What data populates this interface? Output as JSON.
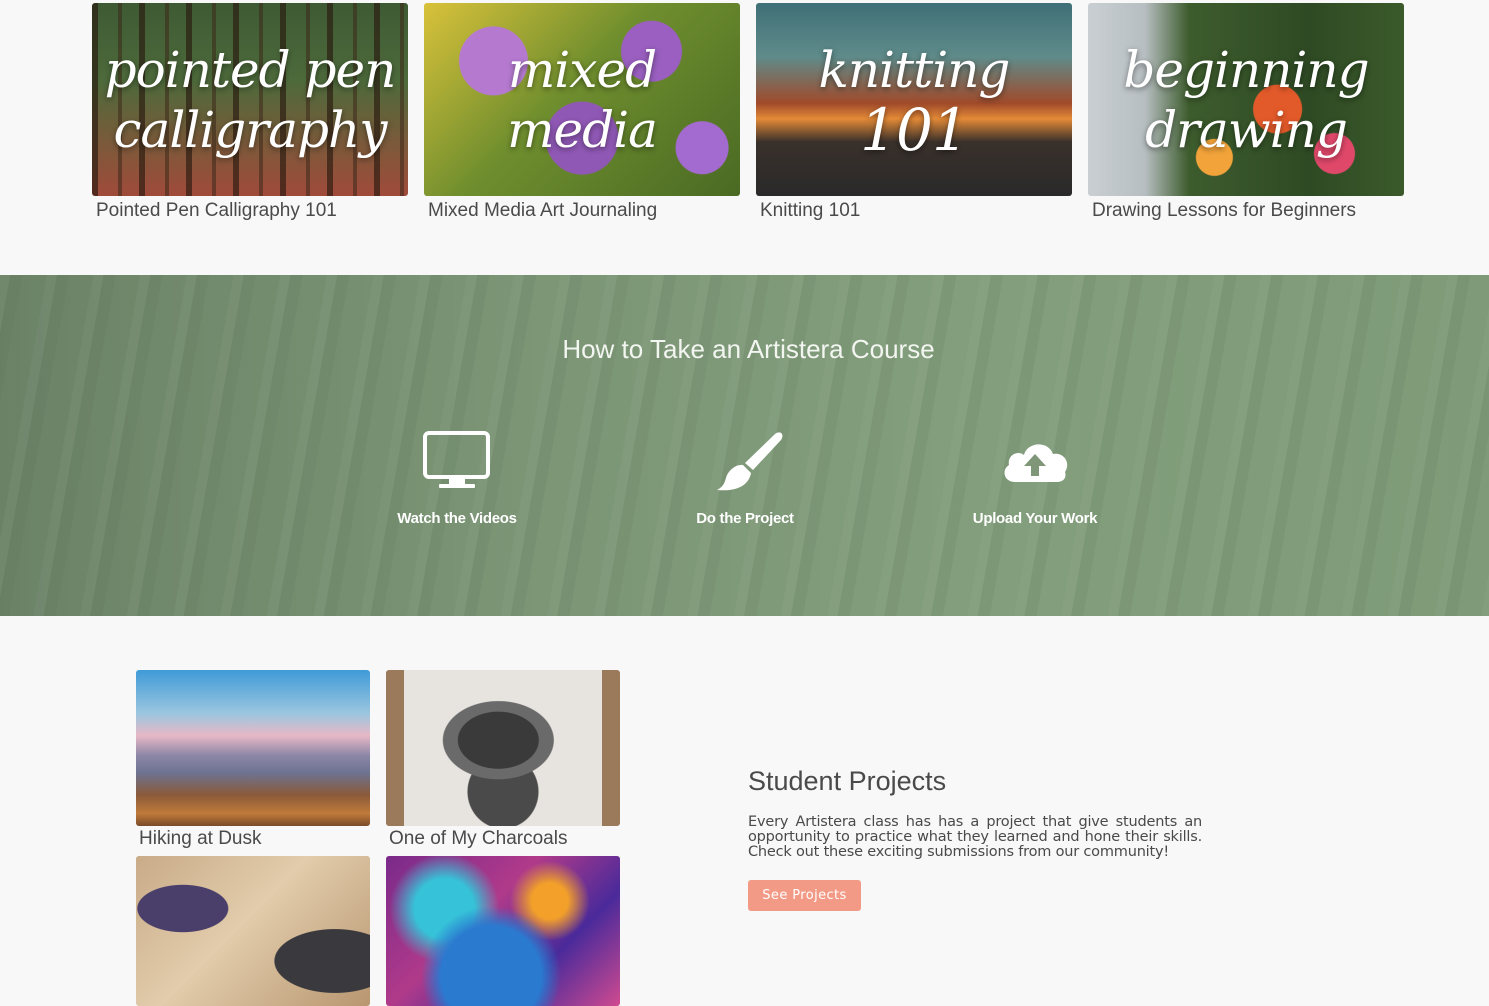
{
  "courses": [
    {
      "thumb_line1": "pointed pen",
      "thumb_line2": "calligraphy",
      "title": "Pointed Pen Calligraphy 101"
    },
    {
      "thumb_line1": "mixed",
      "thumb_line2": "media",
      "title": "Mixed Media Art Journaling"
    },
    {
      "thumb_line1": "knitting",
      "thumb_line2": "101",
      "title": "Knitting 101"
    },
    {
      "thumb_line1": "beginning",
      "thumb_line2": "drawing",
      "title": "Drawing Lessons for Beginners"
    }
  ],
  "how_to": {
    "title": "How to Take an Artistera Course",
    "steps": [
      {
        "icon": "monitor-icon",
        "label": "Watch the Videos"
      },
      {
        "icon": "paintbrush-icon",
        "label": "Do the Project"
      },
      {
        "icon": "cloud-upload-icon",
        "label": "Upload Your Work"
      }
    ]
  },
  "student_projects": {
    "tiles": [
      {
        "caption": "Hiking at Dusk"
      },
      {
        "caption": "One of My Charcoals"
      },
      {
        "caption": ""
      },
      {
        "caption": ""
      }
    ],
    "title": "Student Projects",
    "body": "Every Artistera class has has a project that give students an opportunity to practice what they learned and hone their skills. Check out these exciting submissions from our community!",
    "button_label": "See Projects"
  },
  "colors": {
    "accent_button": "#f39a86",
    "banner_overlay": "#7f9678",
    "page_background": "#f8f8f8"
  }
}
